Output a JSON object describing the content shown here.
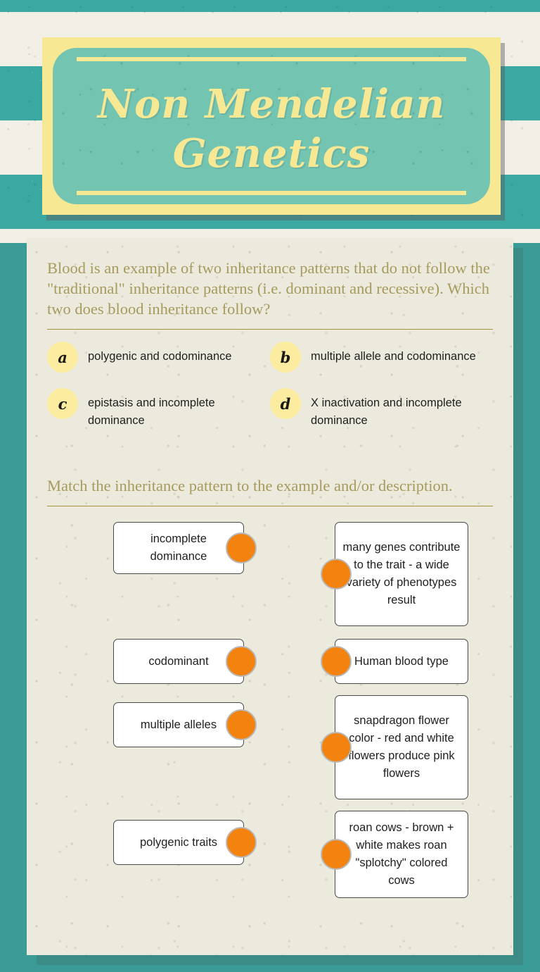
{
  "banner": {
    "title": "Non Mendelian\nGenetics"
  },
  "colors": {
    "teal_background": "#3b9b96",
    "chevron_teal": "#3ba8a2",
    "chevron_cream": "#f2f0e6",
    "banner_border_yellow": "#f7e894",
    "banner_inner_teal": "#74c4b2",
    "sheet_cream": "#eceadd",
    "prompt_olive": "#a79a5e",
    "letter_circle_yellow": "#fbeca0",
    "match_dot_orange": "#f4820f",
    "card_border_gray": "#4a4a4a"
  },
  "question": {
    "prompt": "Blood is an example of two inheritance patterns that do not follow the \"traditional\" inheritance patterns (i.e. dominant and recessive).  Which two does blood inheritance follow?",
    "choices": [
      {
        "letter": "a",
        "text": "polygenic and codominance"
      },
      {
        "letter": "b",
        "text": "multiple allele and codominance"
      },
      {
        "letter": "c",
        "text": "epistasis and incomplete dominance"
      },
      {
        "letter": "d",
        "text": "X inactivation and incomplete dominance"
      }
    ]
  },
  "matching": {
    "prompt": "Match the inheritance pattern to the example and/or description.",
    "left_items": [
      {
        "text": "incomplete dominance"
      },
      {
        "text": "codominant"
      },
      {
        "text": "multiple alleles"
      },
      {
        "text": "polygenic traits"
      }
    ],
    "right_items": [
      {
        "text": "many genes contribute to the trait - a wide variety of phenotypes result"
      },
      {
        "text": "Human blood type"
      },
      {
        "text": "snapdragon flower color - red and white flowers produce pink flowers"
      },
      {
        "text": "roan cows - brown + white makes roan \"splotchy\" colored cows"
      }
    ]
  }
}
